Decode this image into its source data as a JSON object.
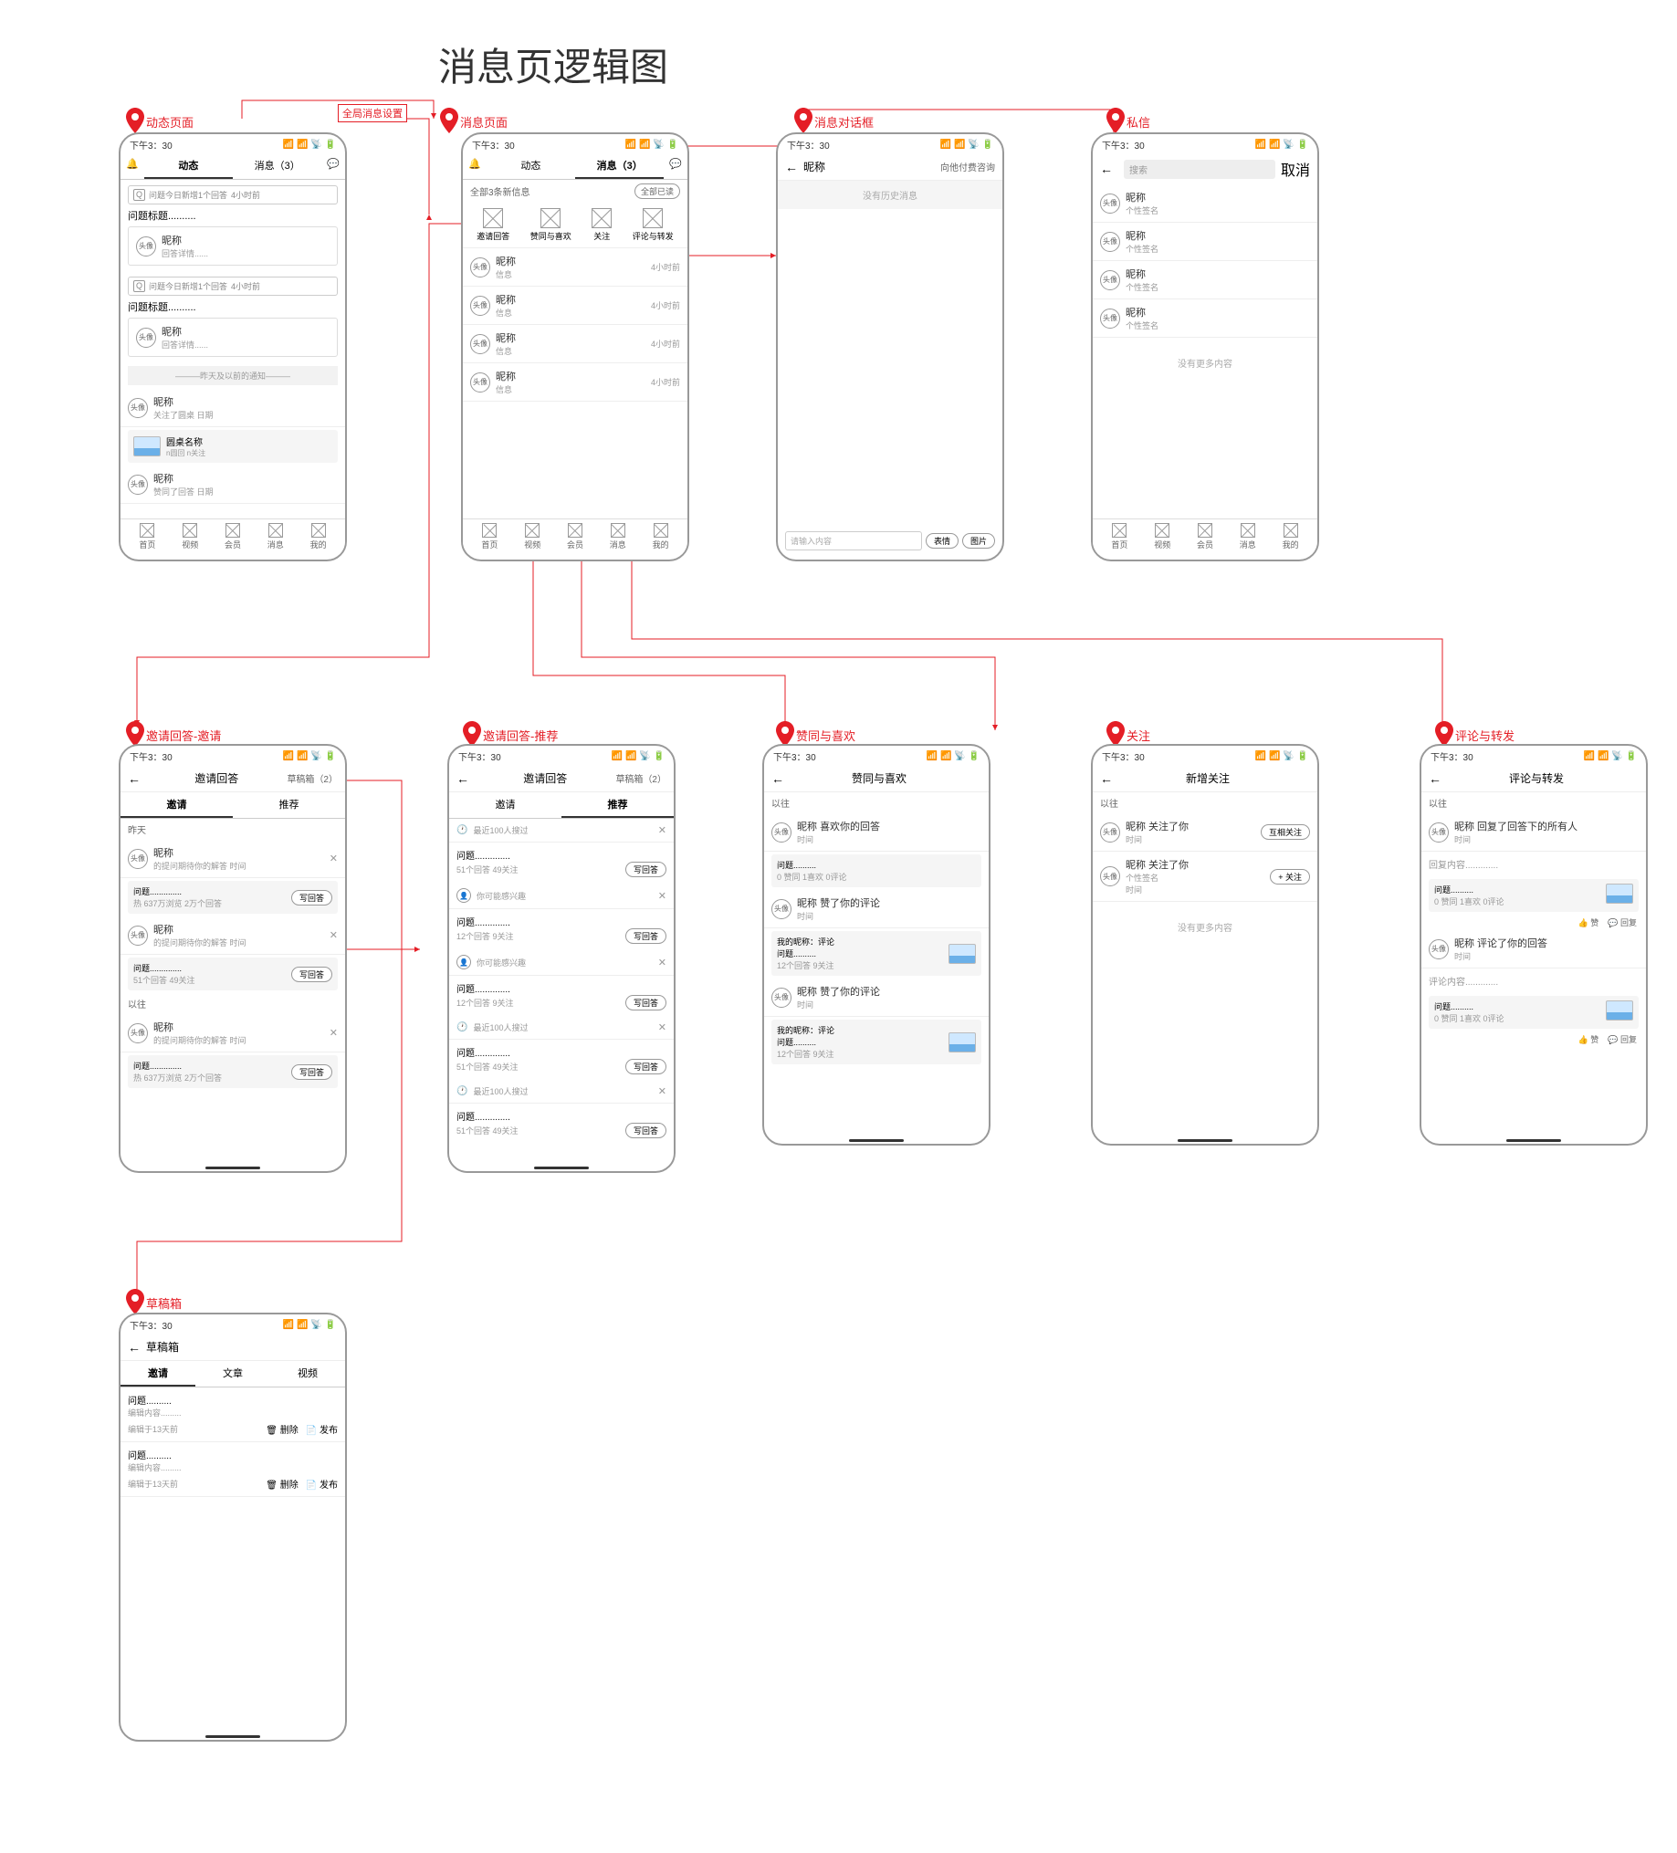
{
  "page_title": "消息页逻辑图",
  "status_time": "下午3：30",
  "global_setting_label": "全局消息设置",
  "pins": {
    "dynamic": "动态页面",
    "message": "消息页面",
    "dialog": "消息对话框",
    "dm": "私信",
    "invite": "邀请回答-邀请",
    "invite_rec": "邀请回答-推荐",
    "like": "赞同与喜欢",
    "follow": "关注",
    "comment": "评论与转发",
    "draft": "草稿箱"
  },
  "tabs": {
    "dynamic": "动态",
    "message": "消息",
    "count": "（3）"
  },
  "nav": [
    "首页",
    "视频",
    "会员",
    "消息",
    "我的"
  ],
  "msg_page": {
    "new_info": "全部3条新信息",
    "all_read": "全部已读",
    "cats": [
      "邀请回答",
      "赞同与喜欢",
      "关注",
      "评论与转发"
    ],
    "rows": {
      "name": "昵称",
      "info": "信息",
      "time": "4小时前"
    }
  },
  "dyn_page": {
    "q_badge": "Q",
    "q_text": "问题今日新增1个回答",
    "q_time": "4小时前",
    "q_title": "问题标题..........",
    "ans_name": "昵称",
    "ans_detail": "回答详情......",
    "divider": "———昨天及以前的通知———",
    "follow_sub": "关注了圆桌 日期",
    "round_name": "圆桌名称",
    "round_sub": "n圆回 n关注",
    "like_sub": "赞同了回答 日期"
  },
  "dialog": {
    "name": "昵称",
    "consult": "向他付费咨询",
    "empty": "没有历史消息",
    "placeholder": "请输入内容",
    "emoji": "表情",
    "pic": "图片"
  },
  "dm": {
    "search": "搜索",
    "cancel": "取消",
    "sig": "个性签名",
    "nomore": "没有更多内容"
  },
  "invite": {
    "header": "邀请回答",
    "draft_tab": "草稿箱",
    "draft_count": "（2）",
    "tab_invite": "邀请",
    "tab_rec": "推荐",
    "yesterday": "昨天",
    "past": "以往",
    "sub": "的提问期待你的解答 时间",
    "q": "问题..............",
    "stat1": "热 637万浏览 2万个回答",
    "stat2": "51个回答 49关注",
    "write": "写回答"
  },
  "invite_rec": {
    "recent": "最近100人搜过",
    "interest": "你可能感兴趣",
    "stat": "12个回答 9关注",
    "stat2": "51个回答 49关注"
  },
  "like": {
    "title": "赞同与喜欢",
    "past": "以往",
    "like_ans": "喜欢你的回答",
    "like_cmt": "赞了你的评论",
    "q": "问题..........",
    "stats": "0 赞同 1喜欢 0评论",
    "me": "我的昵称：评论",
    "cmt_stat": "12个回答 9关注"
  },
  "follow": {
    "title": "新增关注",
    "f_you": "昵称 关注了你",
    "time": "时间",
    "mutual": "互相关注",
    "do_follow": "+ 关注",
    "sig": "个性签名",
    "nomore": "没有更多内容"
  },
  "comment": {
    "title": "评论与转发",
    "r1": "昵称 回复了回答下的所有人",
    "r2": "昵称 评论了你的回答",
    "reply": "回复内容.............",
    "cmt": "评论内容.............",
    "stats": "0 赞同 1喜欢 0评论",
    "like_b": "👍 赞",
    "reply_b": "💬 回复"
  },
  "draft": {
    "title": "草稿箱",
    "tabs": [
      "邀请",
      "文章",
      "视频"
    ],
    "q": "问题..........",
    "content": "编辑内容.........",
    "time": "编辑于13天前",
    "del": "🗑 删除",
    "pub": "📄 发布"
  }
}
